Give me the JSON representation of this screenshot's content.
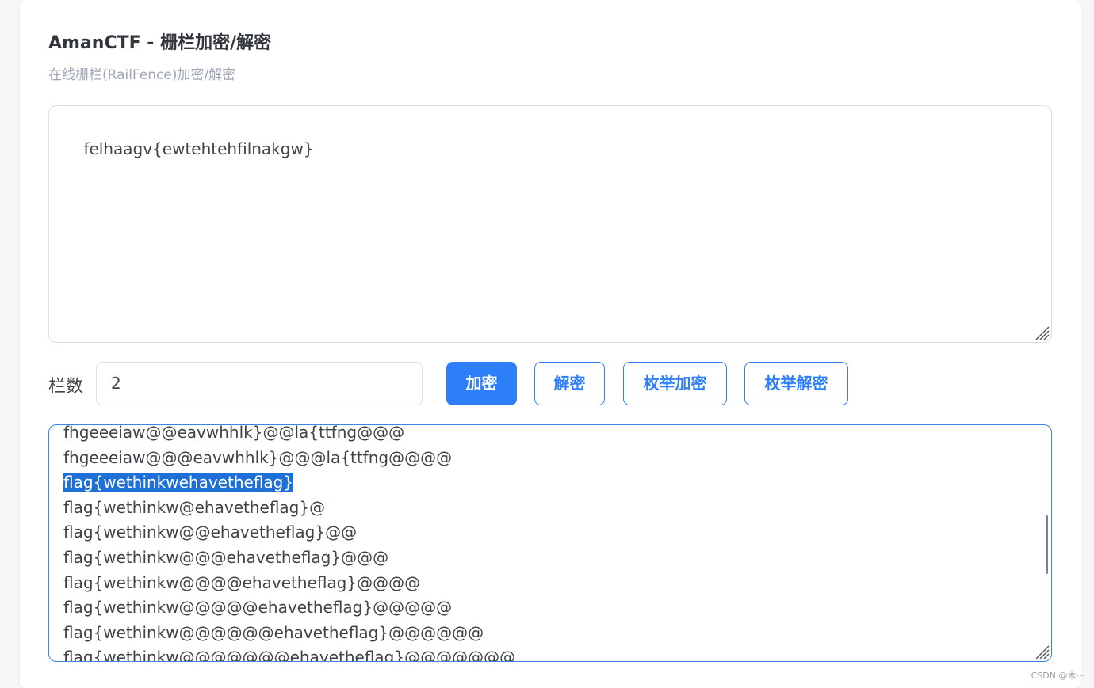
{
  "app": {
    "title": "AmanCTF - 栅栏加密/解密",
    "subtitle": "在线栅栏(RailFence)加密/解密"
  },
  "input": {
    "value": "felhaagv{ewtehtehfilnakgw}"
  },
  "controls": {
    "rails_label": "栏数",
    "rails_value": "2",
    "encrypt_label": "加密",
    "decrypt_label": "解密",
    "enum_encrypt_label": "枚举加密",
    "enum_decrypt_label": "枚举解密"
  },
  "output": {
    "lines": [
      "fhgeeeiaw@@eavwhhlk}@@la{ttfng@@@",
      "fhgeeeiaw@@@eavwhhlk}@@@la{ttfng@@@@",
      "flag{wethinkwehavetheflag}",
      "flag{wethinkw@ehavetheflag}@",
      "flag{wethinkw@@ehavetheflag}@@",
      "flag{wethinkw@@@ehavetheflag}@@@",
      "flag{wethinkw@@@@ehavetheflag}@@@@",
      "flag{wethinkw@@@@@ehavetheflag}@@@@@",
      "flag{wethinkw@@@@@@ehavetheflag}@@@@@@",
      "flag{wethinkw@@@@@@@ehavetheflag}@@@@@@@"
    ],
    "selected_line": "flag{wethinkwehavetheflag}"
  },
  "watermark": "CSDN @木···",
  "colors": {
    "accent": "#2d7ff9",
    "selection": "#1f6fd9"
  }
}
